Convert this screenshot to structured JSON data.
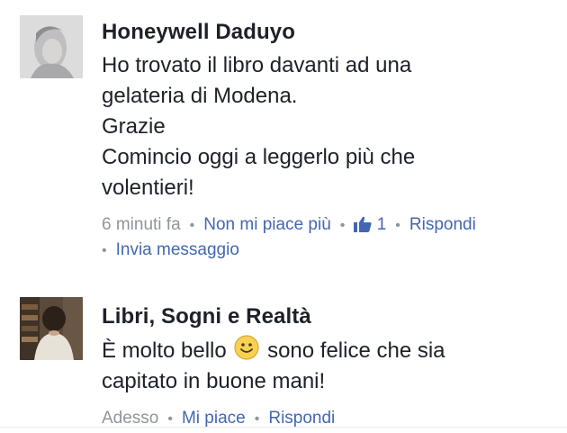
{
  "comments": [
    {
      "author": "Honeywell Daduyo",
      "lines": [
        "Ho trovato il libro davanti ad una",
        "gelateria di Modena.",
        "Grazie",
        "Comincio oggi a leggerlo più che",
        "volentieri!"
      ],
      "time": "6 minuti fa",
      "like_action": "Non mi piace più",
      "like_count": "1",
      "reply": "Rispondi",
      "message": "Invia messaggio"
    },
    {
      "author": "Libri, Sogni e Realtà",
      "line1_before": "È molto bello",
      "line1_after": "sono felice che sia",
      "line2": "capitato in buone mani!",
      "time": "Adesso",
      "like_action": "Mi piace",
      "reply": "Rispondi"
    }
  ],
  "colors": {
    "link": "#4267b2",
    "meta": "#90949c",
    "text": "#1d2129"
  }
}
